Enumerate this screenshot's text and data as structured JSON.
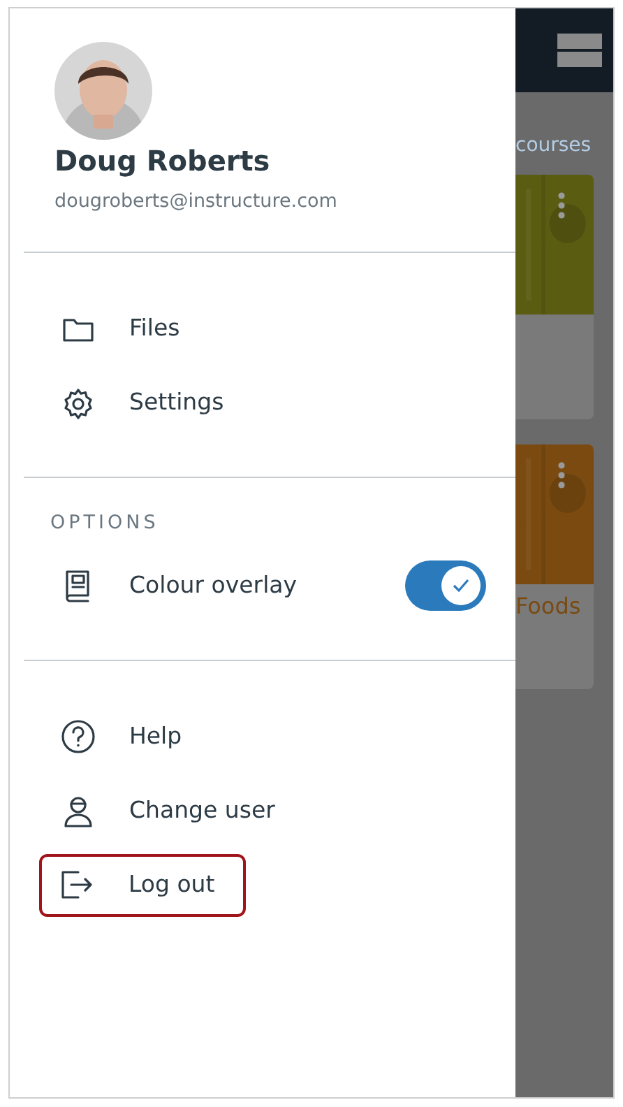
{
  "profile": {
    "name": "Doug Roberts",
    "email": "dougroberts@instructure.com"
  },
  "sections": [
    {
      "items": [
        {
          "label": "Files",
          "highlighted": false
        },
        {
          "label": "Settings",
          "highlighted": false
        }
      ]
    },
    {
      "heading": "OPTIONS",
      "items": [
        {
          "label": "Colour overlay",
          "kind": "toggle",
          "checked": true,
          "highlighted": false
        }
      ]
    },
    {
      "items": [
        {
          "label": "Help",
          "highlighted": false
        },
        {
          "label": "Change user",
          "highlighted": false
        },
        {
          "label": "Log out",
          "highlighted": true
        }
      ]
    }
  ],
  "background": {
    "link": "courses",
    "cards": [
      {
        "color": "#5a5c12"
      },
      {
        "color": "#7a4a10",
        "title": "Foods"
      }
    ]
  }
}
